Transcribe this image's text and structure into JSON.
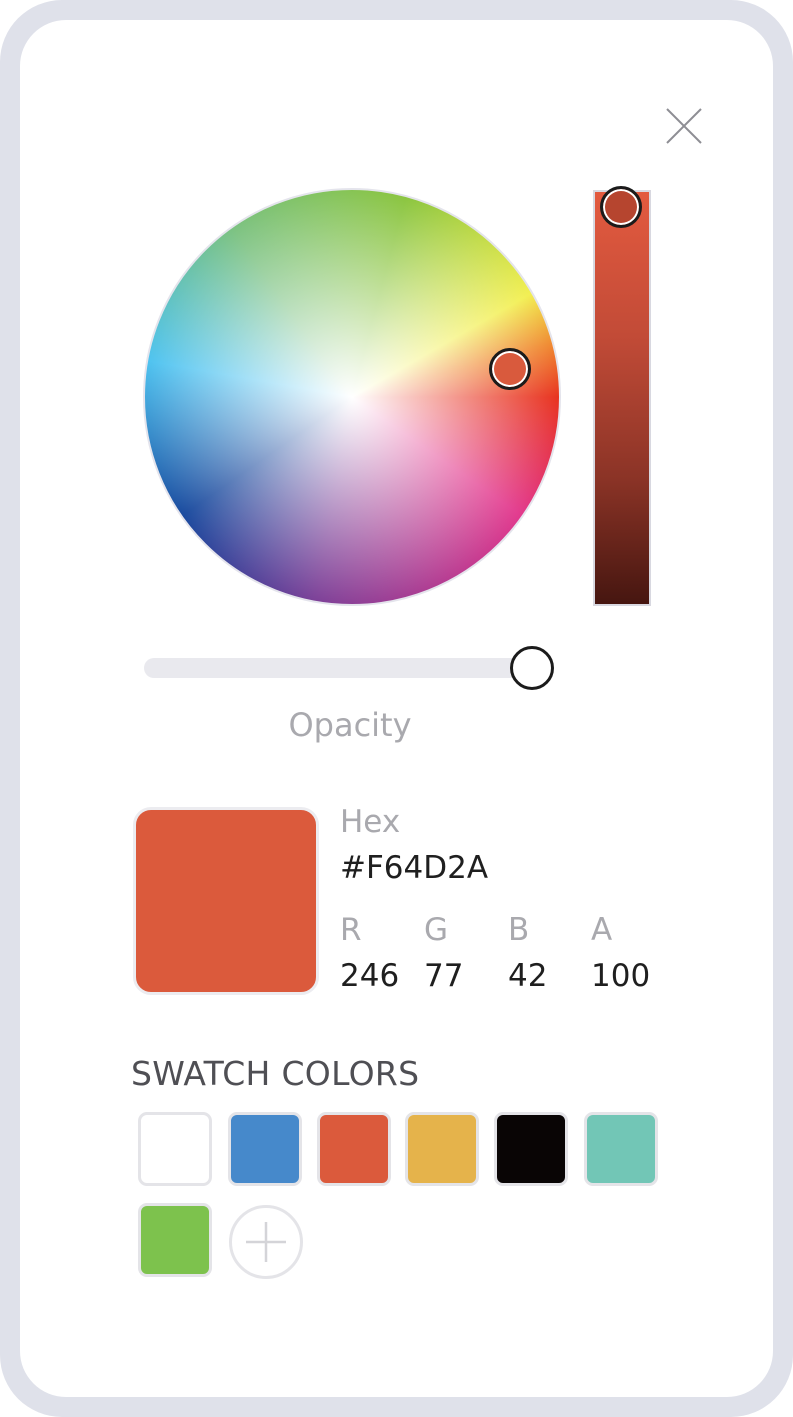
{
  "color": {
    "hex_label": "Hex",
    "hex_value": "#F64D2A",
    "preview_color": "#db5a3c",
    "channels": [
      {
        "label": "R",
        "value": "246"
      },
      {
        "label": "G",
        "value": "77"
      },
      {
        "label": "B",
        "value": "42"
      },
      {
        "label": "A",
        "value": "100"
      }
    ]
  },
  "opacity": {
    "label": "Opacity",
    "level_percent": 100
  },
  "picker": {
    "wheel_handle_color": "#d95a3d",
    "brightness_handle_color": "#b6452f",
    "brightness_level_percent": 100
  },
  "icons": {
    "close": "close-icon",
    "add": "plus-icon"
  },
  "swatches": {
    "heading": "SWATCH COLORS",
    "items": [
      {
        "name": "white",
        "color": "#ffffff"
      },
      {
        "name": "blue",
        "color": "#4689cb"
      },
      {
        "name": "red",
        "color": "#db5a3c"
      },
      {
        "name": "yellow",
        "color": "#e5b34b"
      },
      {
        "name": "black",
        "color": "#090505"
      },
      {
        "name": "teal",
        "color": "#72c6b6"
      },
      {
        "name": "green",
        "color": "#7dc24d"
      }
    ]
  }
}
